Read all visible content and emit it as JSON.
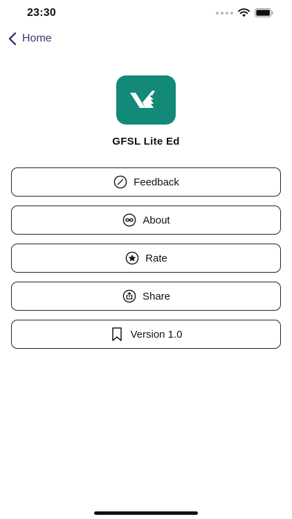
{
  "status_bar": {
    "time": "23:30"
  },
  "nav": {
    "back_label": "Home"
  },
  "app": {
    "name": "GFSL Lite Ed",
    "icon_color": "#138a78"
  },
  "menu": {
    "items": [
      {
        "label": "Feedback",
        "icon": "slash-circle-icon"
      },
      {
        "label": "About",
        "icon": "infinity-circle-icon"
      },
      {
        "label": "Rate",
        "icon": "star-circle-icon"
      },
      {
        "label": "Share",
        "icon": "share-icon"
      },
      {
        "label": "Version 1.0",
        "icon": "bookmark-icon"
      }
    ]
  },
  "colors": {
    "accent": "#3b3470",
    "border": "#222222",
    "background": "#ffffff"
  }
}
